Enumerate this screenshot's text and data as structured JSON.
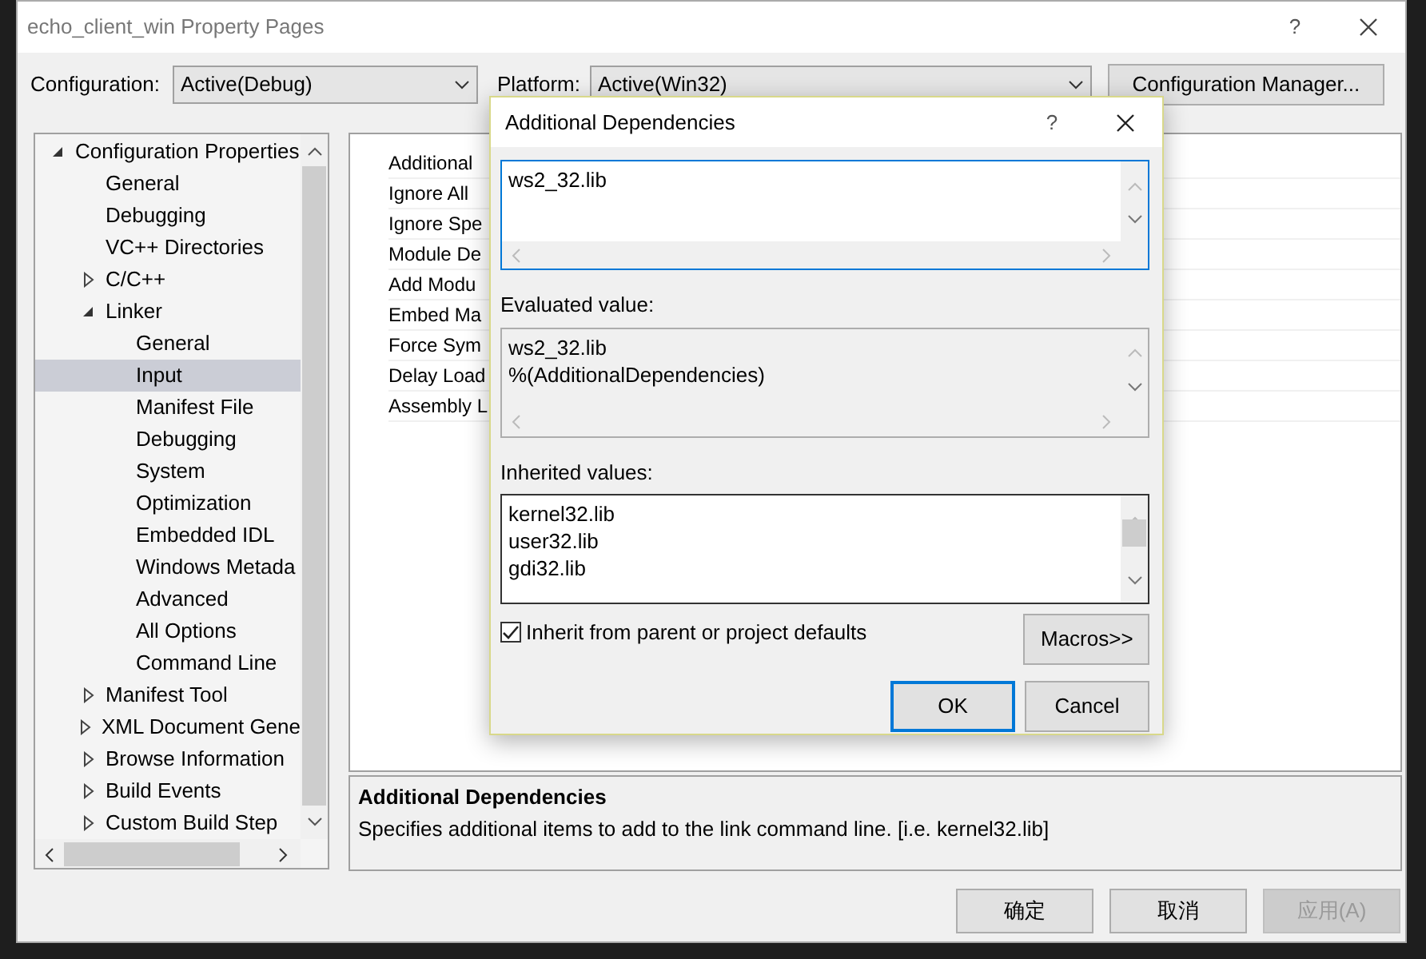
{
  "window": {
    "title": "echo_client_win Property Pages",
    "help": "?"
  },
  "configuration": {
    "label": "Configuration:",
    "value": "Active(Debug)"
  },
  "platform": {
    "label": "Platform:",
    "value": "Active(Win32)"
  },
  "configuration_manager_button": "Configuration Manager...",
  "tree": [
    {
      "label": "Configuration Properties",
      "expanded": true,
      "selected": false,
      "children": [
        {
          "label": "General",
          "selected": false
        },
        {
          "label": "Debugging",
          "selected": false
        },
        {
          "label": "VC++ Directories",
          "selected": false
        },
        {
          "label": "C/C++",
          "expanded": false,
          "selected": false
        },
        {
          "label": "Linker",
          "expanded": true,
          "selected": false,
          "children": [
            {
              "label": "General",
              "selected": false
            },
            {
              "label": "Input",
              "selected": true
            },
            {
              "label": "Manifest File",
              "selected": false
            },
            {
              "label": "Debugging",
              "selected": false
            },
            {
              "label": "System",
              "selected": false
            },
            {
              "label": "Optimization",
              "selected": false
            },
            {
              "label": "Embedded IDL",
              "selected": false
            },
            {
              "label": "Windows Metada",
              "selected": false
            },
            {
              "label": "Advanced",
              "selected": false
            },
            {
              "label": "All Options",
              "selected": false
            },
            {
              "label": "Command Line",
              "selected": false
            }
          ]
        },
        {
          "label": "Manifest Tool",
          "expanded": false,
          "selected": false
        },
        {
          "label": "XML Document Gene",
          "expanded": false,
          "selected": false
        },
        {
          "label": "Browse Information",
          "expanded": false,
          "selected": false
        },
        {
          "label": "Build Events",
          "expanded": false,
          "selected": false
        },
        {
          "label": "Custom Build Step",
          "expanded": false,
          "selected": false
        }
      ]
    }
  ],
  "property_grid": {
    "rows": [
      "Additional",
      "Ignore All",
      "Ignore Spe",
      "Module De",
      "Add Modu",
      "Embed Ma",
      "Force Sym",
      "Delay Load",
      "Assembly L"
    ]
  },
  "description": {
    "title": "Additional Dependencies",
    "text": "Specifies additional items to add to the link command line. [i.e. kernel32.lib]"
  },
  "buttons": [
    {
      "label": "确定",
      "disabled": false
    },
    {
      "label": "取消",
      "disabled": false
    },
    {
      "label": "应用(A)",
      "disabled": true
    }
  ],
  "dialog": {
    "title": "Additional Dependencies",
    "help": "?",
    "value_lines": [
      "ws2_32.lib"
    ],
    "evaluated_label": "Evaluated value:",
    "evaluated_lines": [
      "ws2_32.lib",
      "%(AdditionalDependencies)"
    ],
    "inherited_label": "Inherited values:",
    "inherited_lines": [
      "kernel32.lib",
      "user32.lib",
      "gdi32.lib"
    ],
    "inherit_checkbox": {
      "label": "Inherit from parent or project defaults",
      "checked": true
    },
    "macros_button": "Macros>>",
    "buttons": [
      {
        "label": "OK",
        "default": true
      },
      {
        "label": "Cancel",
        "default": false
      }
    ]
  }
}
